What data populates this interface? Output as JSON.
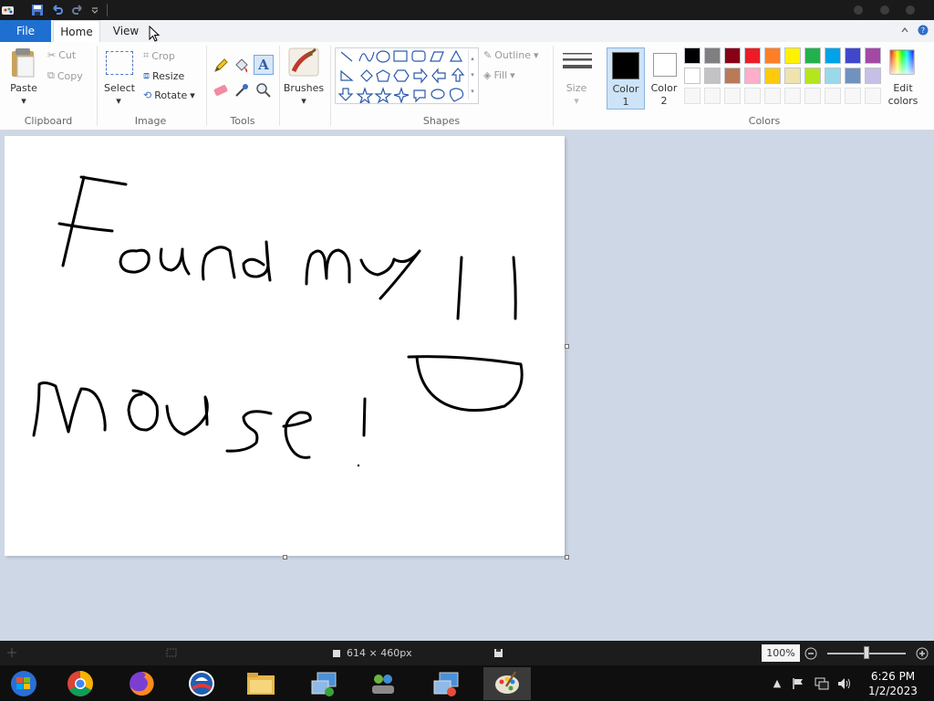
{
  "tabs": {
    "file": "File",
    "home": "Home",
    "view": "View"
  },
  "clipboard": {
    "paste": "Paste",
    "cut": "Cut",
    "copy": "Copy",
    "group_label": "Clipboard"
  },
  "image": {
    "select": "Select",
    "crop": "Crop",
    "resize": "Resize",
    "rotate": "Rotate",
    "group_label": "Image"
  },
  "tools": {
    "group_label": "Tools"
  },
  "brushes": {
    "label": "Brushes"
  },
  "shapes": {
    "outline": "Outline",
    "fill": "Fill",
    "group_label": "Shapes"
  },
  "size": {
    "label": "Size"
  },
  "colors": {
    "color1_label_a": "Color",
    "color1_label_b": "1",
    "color2_label_a": "Color",
    "color2_label_b": "2",
    "edit_label_a": "Edit",
    "edit_label_b": "colors",
    "group_label": "Colors",
    "color1": "#000000",
    "color2": "#ffffff",
    "palette_row1": [
      "#000000",
      "#7f7f7f",
      "#880015",
      "#ed1c24",
      "#ff7f27",
      "#fff200",
      "#22b14c",
      "#00a2e8",
      "#3f48cc",
      "#a349a4"
    ],
    "palette_row2": [
      "#ffffff",
      "#c3c3c3",
      "#b97a57",
      "#ffaec9",
      "#ffc90e",
      "#efe4b0",
      "#b5e61d",
      "#99d9ea",
      "#7092be",
      "#c8bfe7"
    ]
  },
  "status": {
    "dimensions": "614 × 460px",
    "zoom": "100%",
    "zoom_level": 1.0
  },
  "clock": {
    "time": "6:26 PM",
    "date": "1/2/2023"
  }
}
